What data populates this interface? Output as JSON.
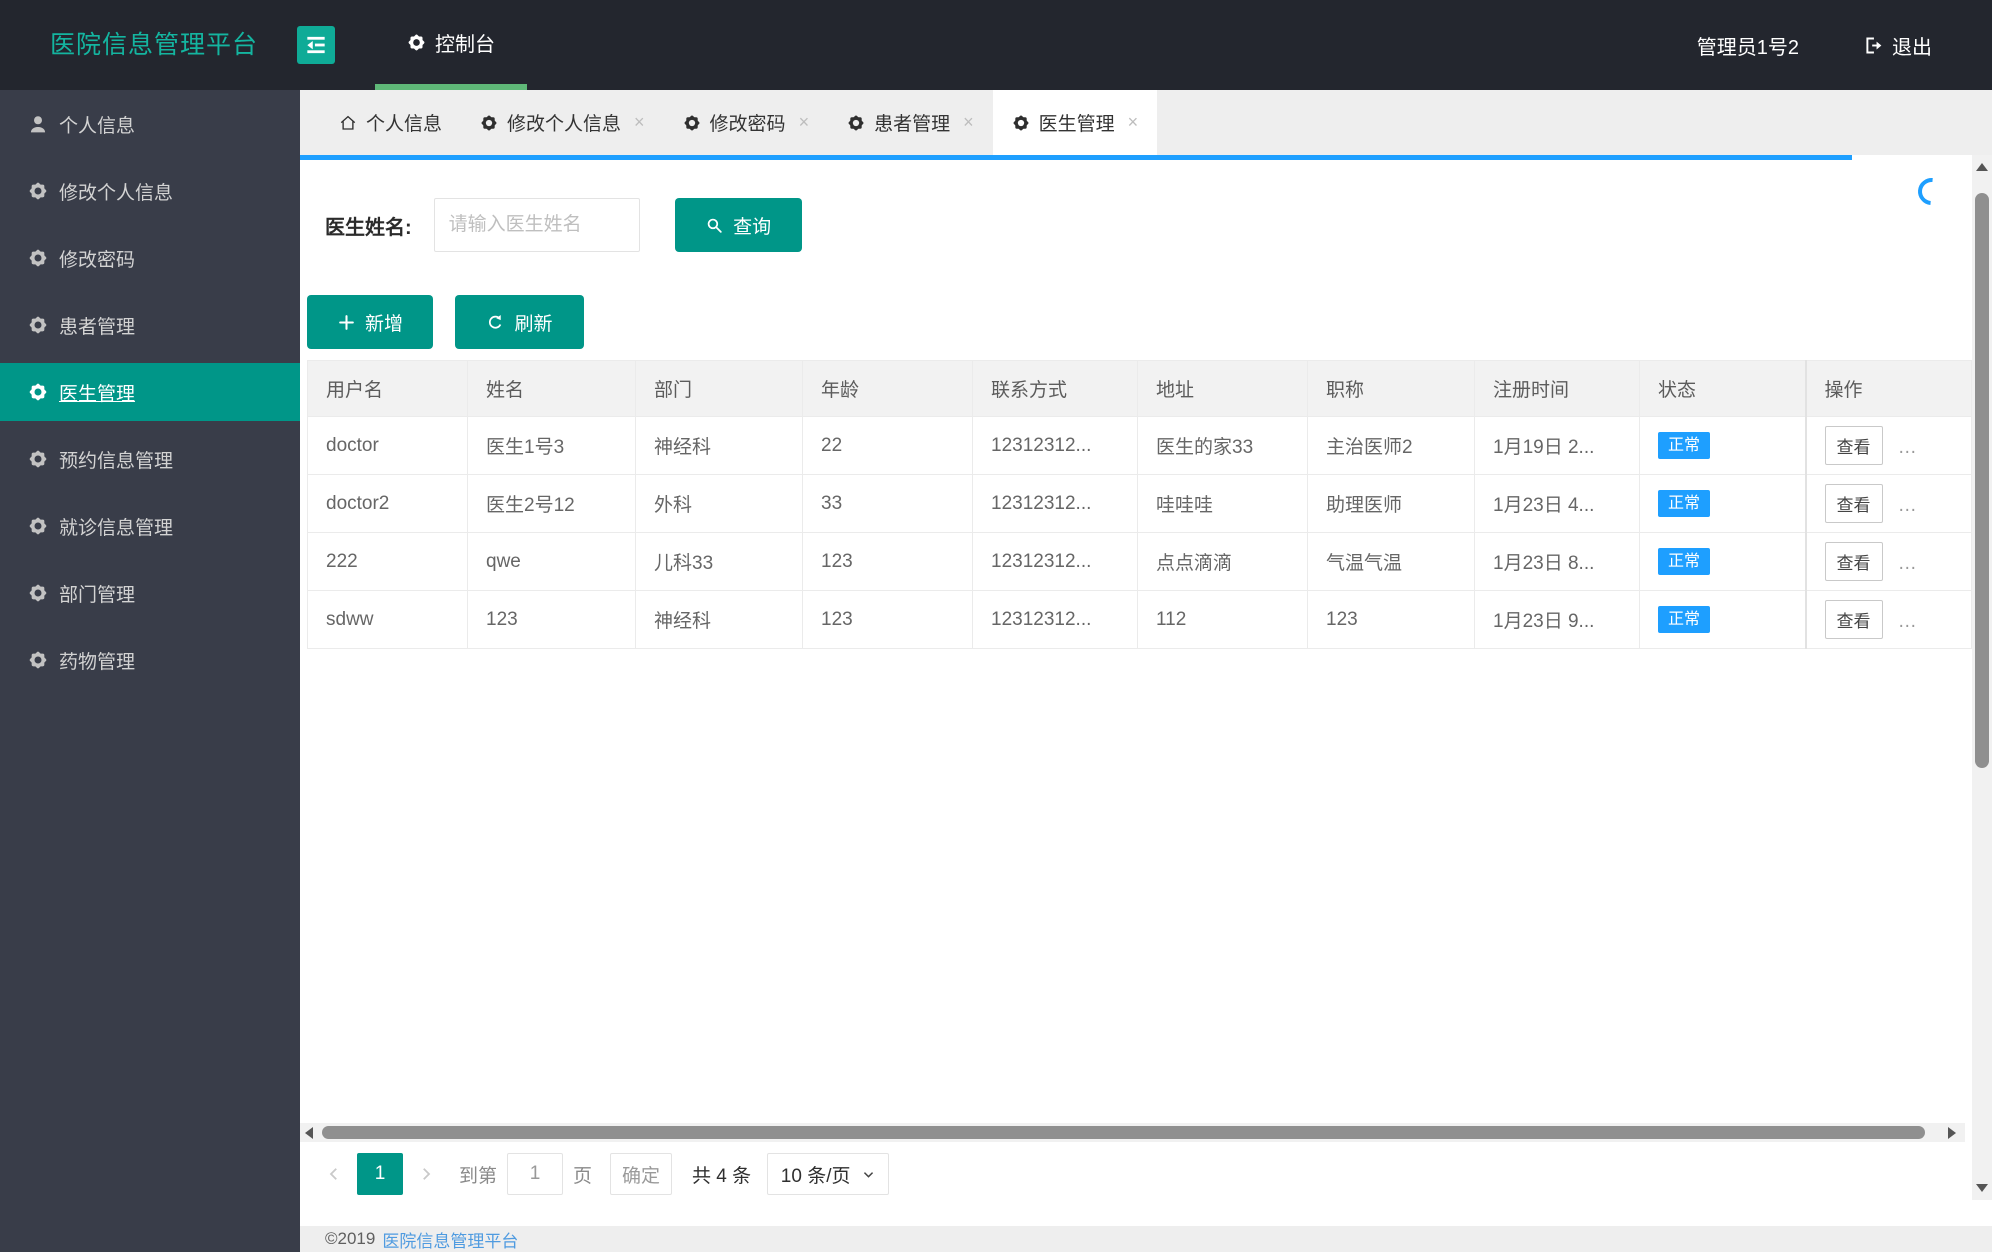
{
  "header": {
    "logo": "医院信息管理平台",
    "console_label": "控制台",
    "username": "管理员1号2",
    "logout_label": "退出"
  },
  "sidebar": {
    "items": [
      {
        "label": "个人信息",
        "icon": "user-icon",
        "active": false
      },
      {
        "label": "修改个人信息",
        "icon": "gear-icon",
        "active": false
      },
      {
        "label": "修改密码",
        "icon": "gear-icon",
        "active": false
      },
      {
        "label": "患者管理",
        "icon": "gear-icon",
        "active": false
      },
      {
        "label": "医生管理",
        "icon": "gear-icon",
        "active": true
      },
      {
        "label": "预约信息管理",
        "icon": "gear-icon",
        "active": false
      },
      {
        "label": "就诊信息管理",
        "icon": "gear-icon",
        "active": false
      },
      {
        "label": "部门管理",
        "icon": "gear-icon",
        "active": false
      },
      {
        "label": "药物管理",
        "icon": "gear-icon",
        "active": false
      }
    ]
  },
  "tabs": [
    {
      "label": "个人信息",
      "icon": "home-icon",
      "closable": false,
      "active": false
    },
    {
      "label": "修改个人信息",
      "icon": "gear-icon",
      "closable": true,
      "active": false
    },
    {
      "label": "修改密码",
      "icon": "gear-icon",
      "closable": true,
      "active": false
    },
    {
      "label": "患者管理",
      "icon": "gear-icon",
      "closable": true,
      "active": false
    },
    {
      "label": "医生管理",
      "icon": "gear-icon",
      "closable": true,
      "active": true
    }
  ],
  "ui": {
    "close_glyph": "×"
  },
  "search": {
    "label": "医生姓名:",
    "placeholder": "请输入医生姓名",
    "submit_label": "查询"
  },
  "toolbar": {
    "add_label": "新增",
    "refresh_label": "刷新"
  },
  "table": {
    "columns": [
      "用户名",
      "姓名",
      "部门",
      "年龄",
      "联系方式",
      "地址",
      "职称",
      "注册时间",
      "状态",
      "操作"
    ],
    "view_label": "查看",
    "more_glyph": "…",
    "rows": [
      {
        "username": "doctor",
        "name": "医生1号3",
        "department": "神经科",
        "age": "22",
        "contact": "12312312...",
        "address": "医生的家33",
        "title": "主治医师2",
        "registered": "1月19日 2...",
        "status": "正常"
      },
      {
        "username": "doctor2",
        "name": "医生2号12",
        "department": "外科",
        "age": "33",
        "contact": "12312312...",
        "address": "哇哇哇",
        "title": "助理医师",
        "registered": "1月23日 4...",
        "status": "正常"
      },
      {
        "username": "222",
        "name": "qwe",
        "department": "儿科33",
        "age": "123",
        "contact": "12312312...",
        "address": "点点滴滴",
        "title": "气温气温",
        "registered": "1月23日 8...",
        "status": "正常"
      },
      {
        "username": "sdww",
        "name": "123",
        "department": "神经科",
        "age": "123",
        "contact": "12312312...",
        "address": "112",
        "title": "123",
        "registered": "1月23日 9...",
        "status": "正常"
      }
    ]
  },
  "pagination": {
    "page": "1",
    "goto_prefix": "到第",
    "goto_value": "1",
    "goto_suffix": "页",
    "confirm_label": "确定",
    "total_label": "共 4 条",
    "page_size_label": "10 条/页"
  },
  "footer": {
    "copyright": "©2019",
    "brand_link": "医院信息管理平台"
  },
  "colors": {
    "header_bg": "#23262e",
    "sidebar_bg": "#393d49",
    "theme_teal": "#009688",
    "logo_teal": "#14b5a0",
    "nav_active_green": "#5fb878",
    "tab_underline_blue": "#1e9fff",
    "status_badge_blue": "#1e9fff",
    "footer_link_blue": "#4f9be0"
  },
  "icons": {
    "collapse": "collapse-menu-icon",
    "console": "gear-icon",
    "logout": "logout-icon",
    "search": "magnifier-icon",
    "add": "plus-icon",
    "refresh": "refresh-icon",
    "pager_prev": "chevron-left-icon",
    "pager_next": "chevron-right-icon",
    "page_size": "caret-down-icon"
  }
}
